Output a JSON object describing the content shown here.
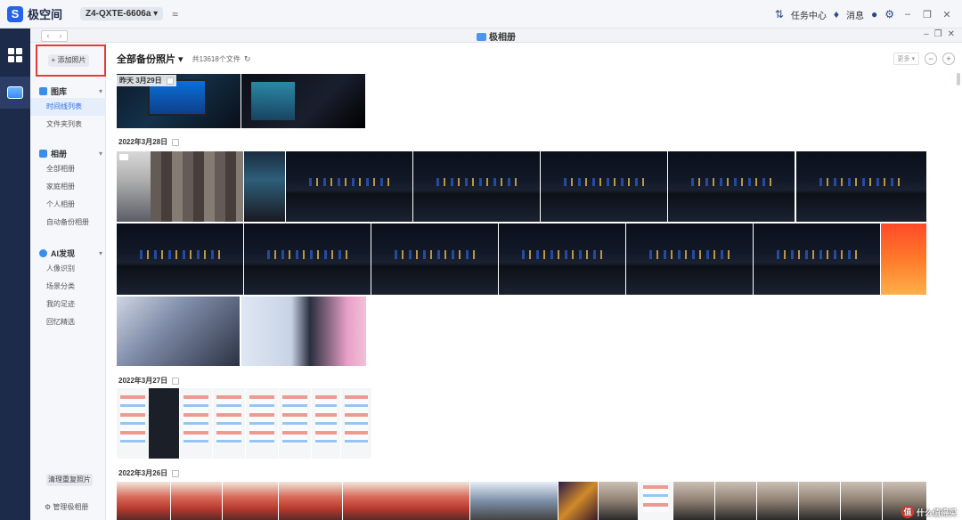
{
  "app": {
    "logo_text": "极空间",
    "device_name": "Z4-QXTE-6606a",
    "task_center_label": "任务中心",
    "messages_label": "消息"
  },
  "window": {
    "title": "极相册"
  },
  "sidebar": {
    "add_photo_label": "+ 添加照片",
    "groups": [
      {
        "label": "图库",
        "items": [
          {
            "label": "时间线列表",
            "active": true
          },
          {
            "label": "文件夹列表",
            "active": false
          }
        ]
      },
      {
        "label": "相册",
        "items": [
          {
            "label": "全部相册"
          },
          {
            "label": "家庭相册"
          },
          {
            "label": "个人相册"
          },
          {
            "label": "自动备份相册"
          }
        ]
      },
      {
        "label": "AI发现",
        "items": [
          {
            "label": "人像识别"
          },
          {
            "label": "场景分类"
          },
          {
            "label": "我的足迹"
          },
          {
            "label": "回忆精选"
          }
        ]
      }
    ],
    "clear_duplicates_label": "清理重复照片",
    "manage_label": "管理极相册"
  },
  "main": {
    "title": "全部备份照片",
    "count_text": "共13618个文件",
    "more_label": "更多",
    "sections": [
      {
        "date": "昨天  3月29日"
      },
      {
        "date": "2022年3月28日"
      },
      {
        "date": "2022年3月27日"
      },
      {
        "date": "2022年3月26日"
      }
    ]
  },
  "watermark": {
    "text": "什么值得买",
    "icon_char": "值"
  },
  "colors": {
    "accent": "#2b6ee6",
    "rail_bg": "#1d2b4a",
    "highlight_border": "#e43b3b"
  }
}
